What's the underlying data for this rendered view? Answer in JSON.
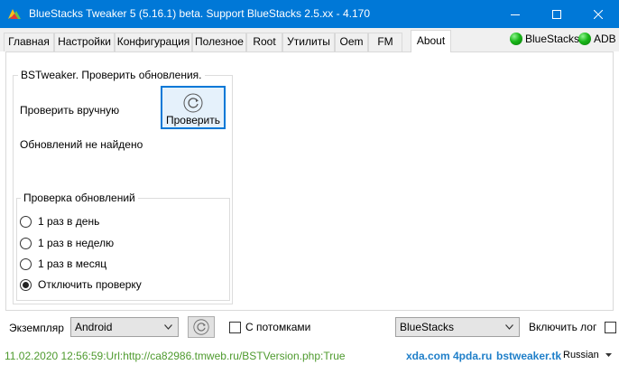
{
  "window": {
    "title": "BlueStacks Tweaker 5 (5.16.1) beta. Support BlueStacks 2.5.xx - 4.170"
  },
  "tabs": [
    {
      "label": "Главная"
    },
    {
      "label": "Настройки"
    },
    {
      "label": "Конфигурация"
    },
    {
      "label": "Полезное"
    },
    {
      "label": "Root"
    },
    {
      "label": "Утилиты"
    },
    {
      "label": "Oem"
    },
    {
      "label": "FM"
    },
    {
      "label": "About",
      "active": true
    }
  ],
  "indicators": [
    {
      "label": "BlueStacks",
      "color": "#19b619"
    },
    {
      "label": "ADB",
      "color": "#19b619"
    }
  ],
  "updates": {
    "group_title": "BSTweaker. Проверить обновления.",
    "manual_label": "Проверить вручную",
    "check_button": "Проверить",
    "result_text": "Обновлений не найдено",
    "schedule": {
      "group_title": "Проверка обновлений",
      "options": [
        "1 раз в день",
        "1 раз в неделю",
        "1 раз в месяц",
        "Отключить проверку"
      ],
      "selected": "Отключить проверку"
    }
  },
  "bottom": {
    "instance_label": "Экземпляр",
    "instance_value": "Android",
    "with_children_label": "С потомками",
    "with_children_checked": false,
    "engine_value": "BlueStacks",
    "enable_log_label": "Включить лог",
    "enable_log_checked": false
  },
  "status": {
    "text": "11.02.2020 12:56:59:Url:http://ca82986.tmweb.ru/BSTVersion.php:True",
    "links": [
      "xda.com",
      "4pda.ru",
      "bstweaker.tk"
    ],
    "language": "Russian"
  },
  "colors": {
    "titlebar": "#0078d7",
    "status_text": "#4e9a2e",
    "link": "#1f7fc9",
    "indicator": "#19b619"
  },
  "icons": {
    "app": "bluestacks-logo-icon",
    "refresh": "refresh-icon",
    "minimize": "minimize-icon",
    "maximize": "maximize-icon",
    "close": "close-icon",
    "dropdown": "chevron-down-icon"
  }
}
